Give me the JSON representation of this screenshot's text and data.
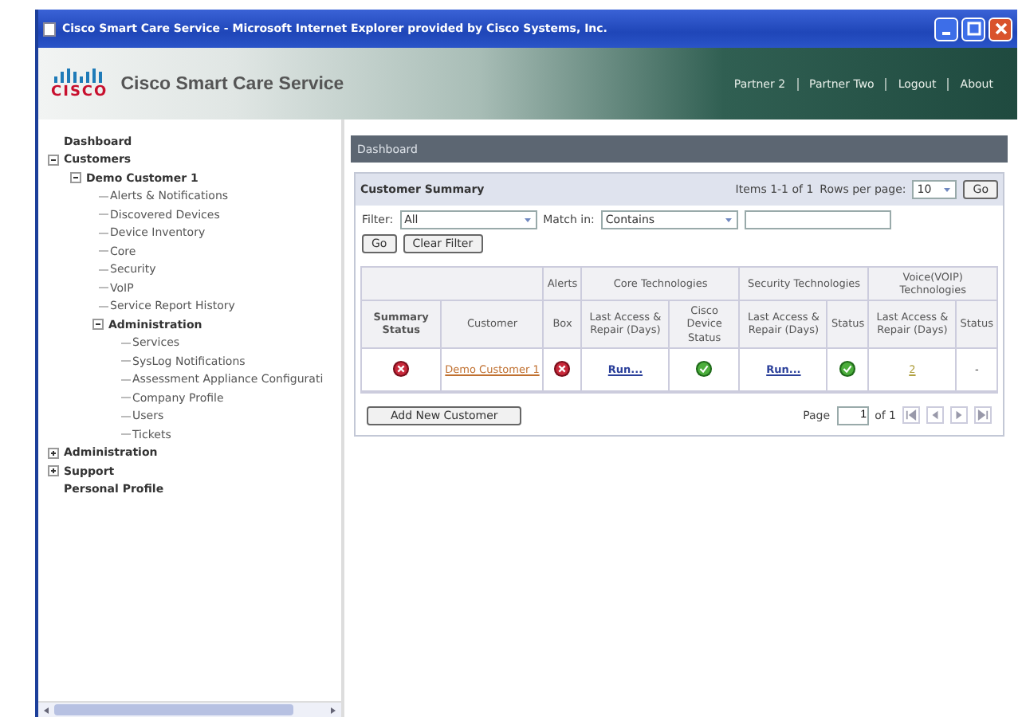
{
  "window": {
    "title": "Cisco Smart Care Service - Microsoft Internet Explorer provided by Cisco Systems, Inc."
  },
  "header": {
    "logo_text": "CISCO",
    "app_name": "Cisco Smart Care Service",
    "links": [
      "Partner 2",
      "Partner Two",
      "Logout",
      "About"
    ]
  },
  "sidebar": {
    "items": [
      {
        "label": "Dashboard",
        "bold": true
      },
      {
        "label": "Customers",
        "bold": true,
        "expanded": true,
        "children": [
          {
            "label": "Demo Customer 1",
            "bold": true,
            "expanded": true,
            "children": [
              {
                "label": "Alerts & Notifications",
                "bold": false
              },
              {
                "label": "Discovered Devices",
                "bold": false
              },
              {
                "label": "Device Inventory",
                "bold": false
              },
              {
                "label": "Core",
                "bold": false
              },
              {
                "label": "Security",
                "bold": false
              },
              {
                "label": "VoIP",
                "bold": false
              },
              {
                "label": "Service Report History",
                "bold": false
              },
              {
                "label": "Administration",
                "bold": true,
                "expanded": true,
                "children": [
                  {
                    "label": "Services",
                    "bold": false
                  },
                  {
                    "label": "SysLog Notifications",
                    "bold": false
                  },
                  {
                    "label": "Assessment Appliance Configurati",
                    "bold": false
                  },
                  {
                    "label": "Company Profile",
                    "bold": false
                  },
                  {
                    "label": "Users",
                    "bold": false
                  },
                  {
                    "label": "Tickets",
                    "bold": false
                  }
                ]
              }
            ]
          }
        ]
      },
      {
        "label": "Administration",
        "bold": true,
        "expanded": false
      },
      {
        "label": "Support",
        "bold": true,
        "expanded": false
      },
      {
        "label": "Personal Profile",
        "bold": true
      }
    ]
  },
  "breadcrumb": "Dashboard",
  "summary": {
    "title": "Customer Summary",
    "items_info": "Items 1-1 of 1",
    "rows_label": "Rows per page:",
    "rows_value": "10",
    "go": "Go",
    "filter_label": "Filter:",
    "filter_value": "All",
    "match_label": "Match in:",
    "match_value": "Contains",
    "go2": "Go",
    "clear": "Clear Filter",
    "column_groups": [
      {
        "label": "Alerts"
      },
      {
        "label": "Core Technologies"
      },
      {
        "label": "Security Technologies"
      },
      {
        "label": "Voice(VOIP) Technologies"
      }
    ],
    "columns": [
      {
        "label": "Summary Status",
        "bold": true
      },
      {
        "label": "Customer",
        "bold": false
      },
      {
        "starts_group": true,
        "label": "Box",
        "bold": false
      },
      {
        "starts_group": true,
        "label": "Last Access & Repair (Days)",
        "bold": false
      },
      {
        "same_group": true,
        "label": "Cisco Device Status",
        "bold": false
      },
      {
        "starts_group": true,
        "label": "Last Access & Repair (Days)",
        "bold": false
      },
      {
        "same_group": true,
        "label": "Status",
        "bold": false
      },
      {
        "starts_group": true,
        "label": "Last Access & Repair (Days)",
        "bold": false
      },
      {
        "same_group": true,
        "label": "Status",
        "bold": false
      }
    ],
    "rows": [
      [
        {
          "kind": "error"
        },
        {
          "kind": "customer",
          "text": "Demo Customer 1"
        },
        {
          "kind": "error"
        },
        {
          "kind": "link",
          "text": "Run..."
        },
        {
          "kind": "ok"
        },
        {
          "kind": "link",
          "text": "Run..."
        },
        {
          "kind": "ok"
        },
        {
          "kind": "number",
          "text": "2"
        },
        {
          "kind": "text",
          "text": "-"
        }
      ]
    ],
    "add_button": "Add New Customer",
    "page_label": "Page",
    "page_value": "1",
    "page_of": "of 1"
  }
}
